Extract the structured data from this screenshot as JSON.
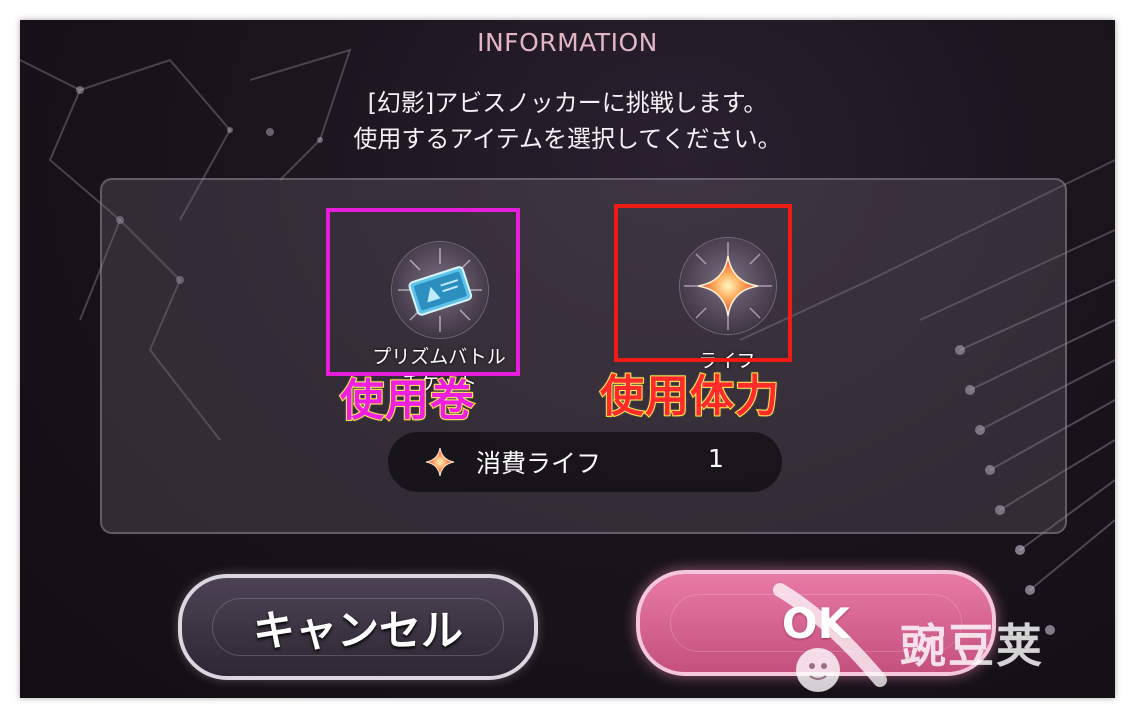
{
  "dialog": {
    "title": "INFORMATION",
    "message_line1": "[幻影]アビスノッカーに挑戦します。",
    "message_line2": "使用するアイテムを選択してください。"
  },
  "items": [
    {
      "label_line1": "プリズムバトル",
      "label_line2": "チケット",
      "icon": "ticket-icon"
    },
    {
      "label_line1": "ライフ",
      "label_line2": "",
      "icon": "life-star-icon"
    }
  ],
  "annotations": {
    "ticket": "使用卷",
    "life": "使用体力"
  },
  "cost": {
    "label": "消費ライフ",
    "value": "1",
    "icon": "life-star-icon"
  },
  "buttons": {
    "cancel": "キャンセル",
    "ok": "OK"
  },
  "watermark": {
    "text": "豌豆荚"
  },
  "colors": {
    "title": "#e3b4c4",
    "ok_button": "#d8608e",
    "cancel_button": "#3a3140",
    "ticket_highlight": "#e61edc",
    "life_highlight": "#ee1c14",
    "annotation_fill_ticket": "#ee20e0",
    "annotation_fill_life": "#ff2a2a",
    "annotation_stroke": "#ffe600"
  }
}
